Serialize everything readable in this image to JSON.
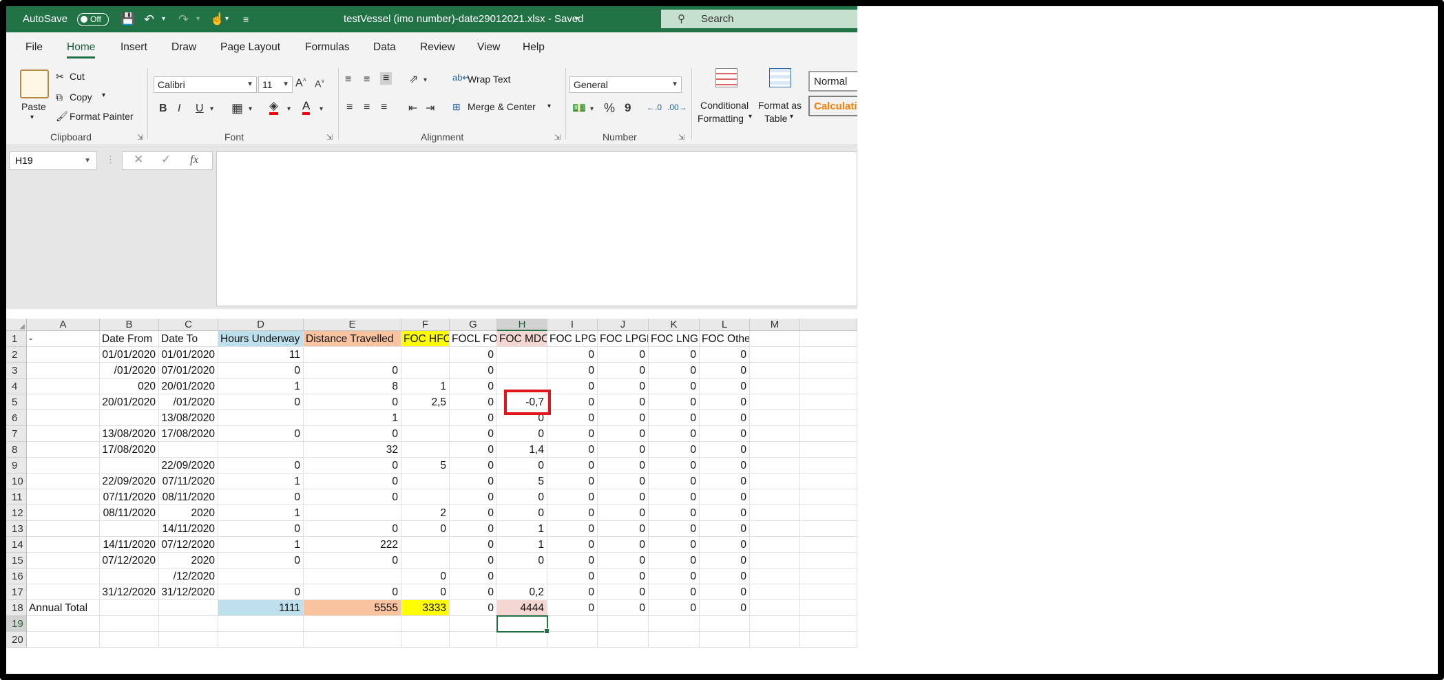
{
  "titlebar": {
    "autosave_label": "AutoSave",
    "autosave_state": "Off",
    "doc_title": "testVessel (imo number)-date29012021.xlsx  -  Saved",
    "search_placeholder": "Search",
    "bg_color": "#217346"
  },
  "ribbon_tabs": [
    "File",
    "Home",
    "Insert",
    "Draw",
    "Page Layout",
    "Formulas",
    "Data",
    "Review",
    "View",
    "Help"
  ],
  "active_tab": "Home",
  "ribbon": {
    "clipboard": {
      "paste": "Paste",
      "cut": "Cut",
      "copy": "Copy",
      "format_painter": "Format Painter",
      "label": "Clipboard"
    },
    "font": {
      "font_name": "Calibri",
      "font_size": "11",
      "bold": "B",
      "italic": "I",
      "underline": "U",
      "label": "Font"
    },
    "alignment": {
      "wrap_text": "Wrap Text",
      "merge_center": "Merge & Center",
      "label": "Alignment"
    },
    "number": {
      "format": "General",
      "percent": "%",
      "comma": "9",
      "label": "Number"
    },
    "styles": {
      "conditional_1": "Conditional",
      "conditional_2": "Formatting",
      "format_as_1": "Format as",
      "format_as_2": "Table",
      "normal": "Normal",
      "calculation": "Calculation"
    }
  },
  "formula_bar": {
    "name_box": "H19",
    "cancel": "✕",
    "enter": "✓",
    "fx": "fx",
    "formula": ""
  },
  "sheet": {
    "columns": [
      "A",
      "B",
      "C",
      "D",
      "E",
      "F",
      "G",
      "H",
      "I",
      "J",
      "K",
      "L",
      "M"
    ],
    "selected_column": "H",
    "row_numbers": [
      "1",
      "2",
      "3",
      "4",
      "5",
      "6",
      "7",
      "8",
      "9",
      "10",
      "11",
      "12",
      "13",
      "14",
      "15",
      "16",
      "17",
      "18",
      "19",
      "20"
    ],
    "selected_row": "19",
    "header_row": [
      "-",
      "Date From",
      "Date To",
      "Hours Underway",
      "Distance Travelled",
      "FOC HFO",
      "FOCL FO",
      "FOC MDO",
      "FOC LPGP",
      "FOC LPGB",
      "FOC LNG",
      "FOC Other",
      ""
    ],
    "rows": [
      [
        "",
        "01/01/2020",
        "01/01/2020",
        "11",
        "",
        "",
        "0",
        "",
        "0",
        "0",
        "0",
        "0",
        ""
      ],
      [
        "",
        "/01/2020",
        "07/01/2020",
        "0",
        "0",
        "",
        "0",
        "",
        "0",
        "0",
        "0",
        "0",
        ""
      ],
      [
        "",
        "020",
        "20/01/2020",
        "1",
        "8",
        "1",
        "0",
        "",
        "0",
        "0",
        "0",
        "0",
        ""
      ],
      [
        "",
        "20/01/2020",
        "/01/2020",
        "0",
        "0",
        "2,5",
        "0",
        "-0,7",
        "0",
        "0",
        "0",
        "0",
        ""
      ],
      [
        "",
        "",
        "13/08/2020",
        "",
        "1",
        "",
        "0",
        "0",
        "0",
        "0",
        "0",
        "0",
        ""
      ],
      [
        "",
        "13/08/2020",
        "17/08/2020",
        "0",
        "0",
        "",
        "0",
        "0",
        "0",
        "0",
        "0",
        "0",
        ""
      ],
      [
        "",
        "17/08/2020",
        "",
        "",
        "32",
        "",
        "0",
        "1,4",
        "0",
        "0",
        "0",
        "0",
        ""
      ],
      [
        "",
        "",
        "22/09/2020",
        "0",
        "0",
        "5",
        "0",
        "0",
        "0",
        "0",
        "0",
        "0",
        ""
      ],
      [
        "",
        "22/09/2020",
        "07/11/2020",
        "1",
        "0",
        "",
        "0",
        "5",
        "0",
        "0",
        "0",
        "0",
        ""
      ],
      [
        "",
        "07/11/2020",
        "08/11/2020",
        "0",
        "0",
        "",
        "0",
        "0",
        "0",
        "0",
        "0",
        "0",
        ""
      ],
      [
        "",
        "08/11/2020",
        "2020",
        "1",
        "",
        "2",
        "0",
        "0",
        "0",
        "0",
        "0",
        "0",
        ""
      ],
      [
        "",
        "",
        "14/11/2020",
        "0",
        "0",
        "0",
        "0",
        "1",
        "0",
        "0",
        "0",
        "0",
        ""
      ],
      [
        "",
        "14/11/2020",
        "07/12/2020",
        "1",
        "222",
        "",
        "0",
        "1",
        "0",
        "0",
        "0",
        "0",
        ""
      ],
      [
        "",
        "07/12/2020",
        "2020",
        "0",
        "0",
        "",
        "0",
        "0",
        "0",
        "0",
        "0",
        "0",
        ""
      ],
      [
        "",
        "",
        "/12/2020",
        "",
        "",
        "0",
        "0",
        "",
        "0",
        "0",
        "0",
        "0",
        ""
      ],
      [
        "",
        "31/12/2020",
        "31/12/2020",
        "0",
        "0",
        "0",
        "0",
        "0,2",
        "0",
        "0",
        "0",
        "0",
        ""
      ],
      [
        "Annual Total",
        "",
        "",
        "1111",
        "5555",
        "3333",
        "0",
        "4444",
        "0",
        "0",
        "0",
        "0",
        ""
      ],
      [
        "",
        "",
        "",
        "",
        "",
        "",
        "",
        "",
        "",
        "",
        "",
        "",
        ""
      ],
      [
        "",
        "",
        "",
        "",
        "",
        "",
        "",
        "",
        "",
        "",
        "",
        "",
        ""
      ]
    ],
    "colors": {
      "hours": "#bde0ec",
      "distance": "#f8c39e",
      "hfo": "#ffff00",
      "mdo": "#f4d7d3",
      "highlight_box": "#e3151c"
    }
  }
}
